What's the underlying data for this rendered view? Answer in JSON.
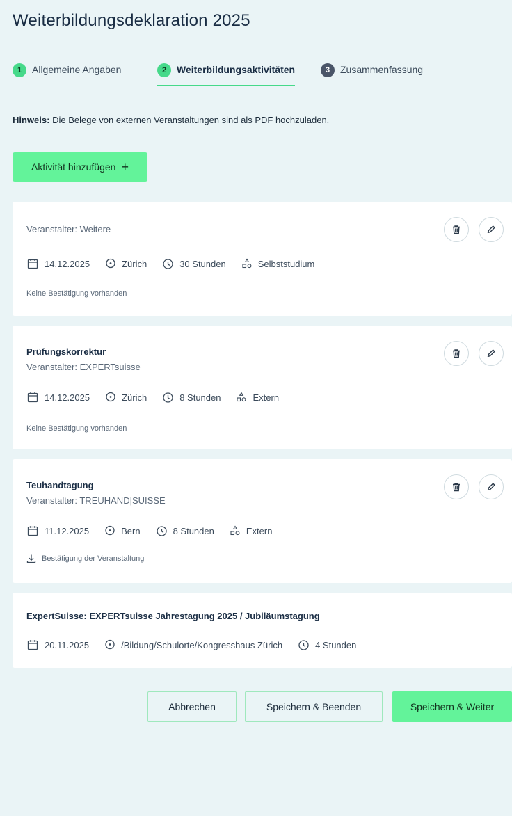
{
  "page": {
    "title": "Weiterbildungsdeklaration 2025"
  },
  "steps": [
    {
      "num": "1",
      "label": "Allgemeine Angaben",
      "state": "done"
    },
    {
      "num": "2",
      "label": "Weiterbildungsaktivitäten",
      "state": "active"
    },
    {
      "num": "3",
      "label": "Zusammenfassung",
      "state": "todo"
    }
  ],
  "hint": {
    "bold": "Hinweis:",
    "text": " Die Belege von externen Veranstaltungen sind als PDF hochzuladen."
  },
  "add_button": {
    "label": "Aktivität hinzufügen",
    "icon": "+"
  },
  "activities": [
    {
      "title": "",
      "organizer": "Veranstalter: Weitere",
      "date": "14.12.2025",
      "location": "Zürich",
      "duration": "30 Stunden",
      "type": "Selbststudium",
      "confirmation": "Keine Bestätigung vorhanden"
    },
    {
      "title": "Prüfungskorrektur",
      "organizer": "Veranstalter: EXPERTsuisse",
      "date": "14.12.2025",
      "location": "Zürich",
      "duration": "8 Stunden",
      "type": "Extern",
      "confirmation": "Keine Bestätigung vorhanden"
    },
    {
      "title": "Teuhandtagung",
      "organizer": "Veranstalter: TREUHAND|SUISSE",
      "date": "11.12.2025",
      "location": "Bern",
      "duration": "8 Stunden",
      "type": "Extern",
      "confirmation": "Bestätigung der Veranstaltung"
    },
    {
      "title": "ExpertSuisse: EXPERTsuisse Jahrestagung 2025 / Jubiläumstagung",
      "date": "20.11.2025",
      "location": "/Bildung/Schulorte/Kongresshaus Zürich",
      "duration": "4 Stunden"
    }
  ],
  "footer": {
    "cancel": "Abbrechen",
    "save_exit": "Speichern & Beenden",
    "save_next": "Speichern & Weiter"
  },
  "colors": {
    "accent": "#63f39a",
    "background": "#eaf4f6",
    "card": "#ffffff",
    "step_todo": "#4a5568"
  }
}
